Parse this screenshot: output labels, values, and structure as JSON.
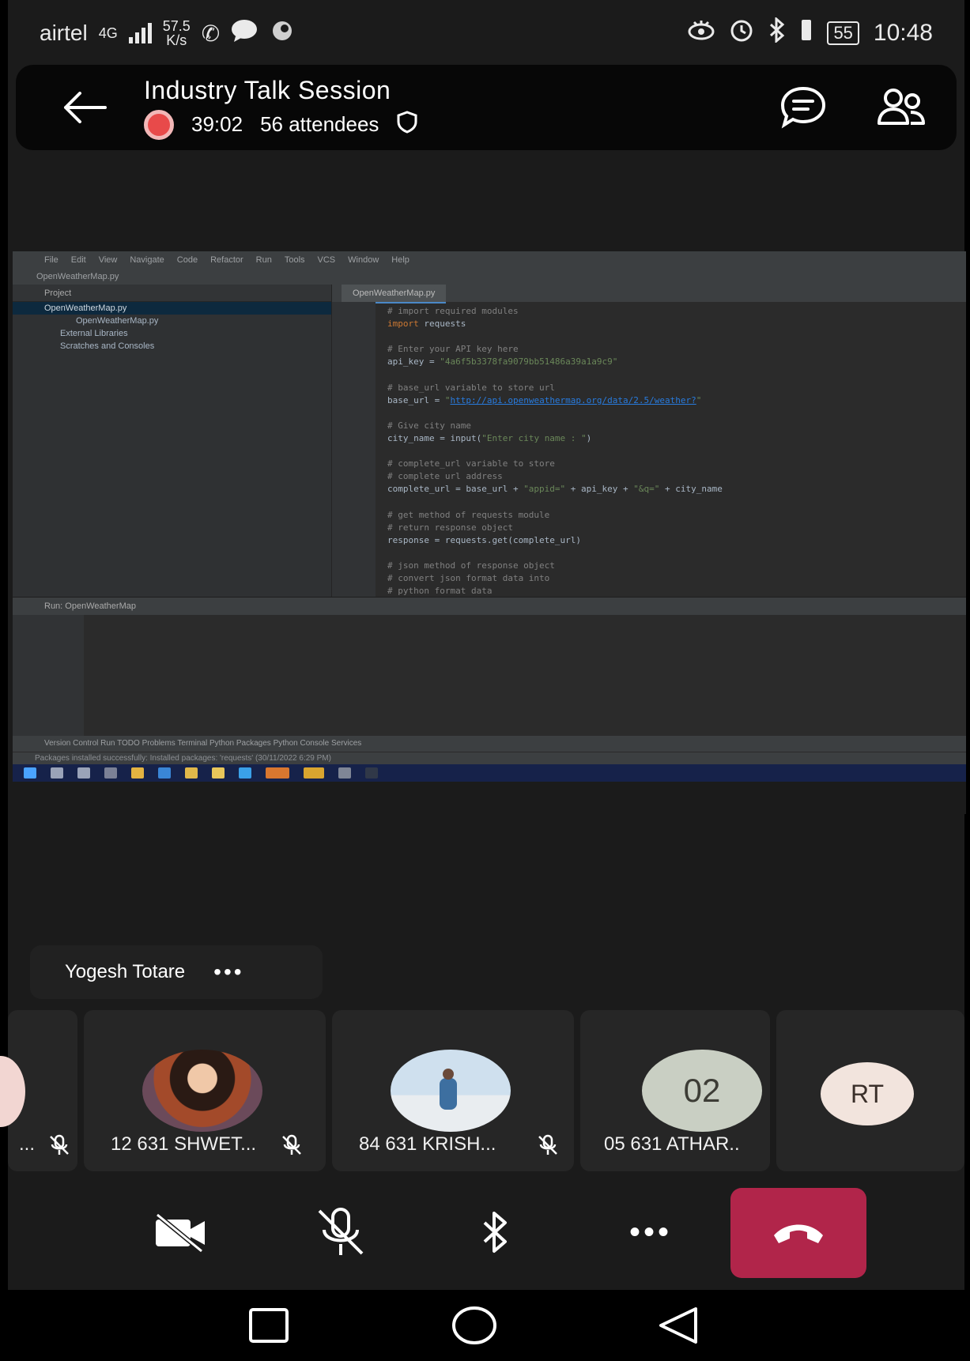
{
  "status_bar": {
    "carrier": "airtel",
    "network": "4G",
    "speed_value": "57.5",
    "speed_unit": "K/s",
    "battery": "55",
    "time": "10:48"
  },
  "header": {
    "title": "Industry Talk Session",
    "elapsed": "39:02",
    "attendees": "56 attendees"
  },
  "shared_screen": {
    "menu": [
      "File",
      "Edit",
      "View",
      "Navigate",
      "Code",
      "Refactor",
      "Run",
      "Tools",
      "VCS",
      "Window",
      "Help"
    ],
    "crumb": "OpenWeatherMap.py",
    "project_header": "Project",
    "project_tree": [
      "OpenWeatherMap.py",
      "OpenWeatherMap.py",
      "External Libraries",
      "Scratches and Consoles"
    ],
    "tab": "OpenWeatherMap.py",
    "run_header": "Run:   OpenWeatherMap",
    "tool_strip": "Version Control    Run    TODO    Problems    Terminal    Python Packages    Python Console    Services",
    "status_strip": "Packages installed successfully: Installed packages: 'requests' (30/11/2022 6:29 PM)"
  },
  "speaker": {
    "name": "Yogesh Totare",
    "more": "•••"
  },
  "participants": [
    {
      "name": "...",
      "muted": true
    },
    {
      "name": "12 631 SHWET...",
      "muted": true
    },
    {
      "name": "84 631 KRISH...",
      "muted": true
    },
    {
      "name": "05 631 ATHAR..",
      "initials": "02",
      "muted": false
    },
    {
      "name": "",
      "initials": "RT",
      "muted": false
    }
  ],
  "controls": {
    "more": "•••"
  },
  "colors": {
    "background": "#1b1b1b",
    "header": "#070707",
    "hangup": "#b1254a",
    "recording": "#e84a4a",
    "initials_02_bg": "#c9cfc3",
    "initials_rt_bg": "#f2e4dd"
  }
}
